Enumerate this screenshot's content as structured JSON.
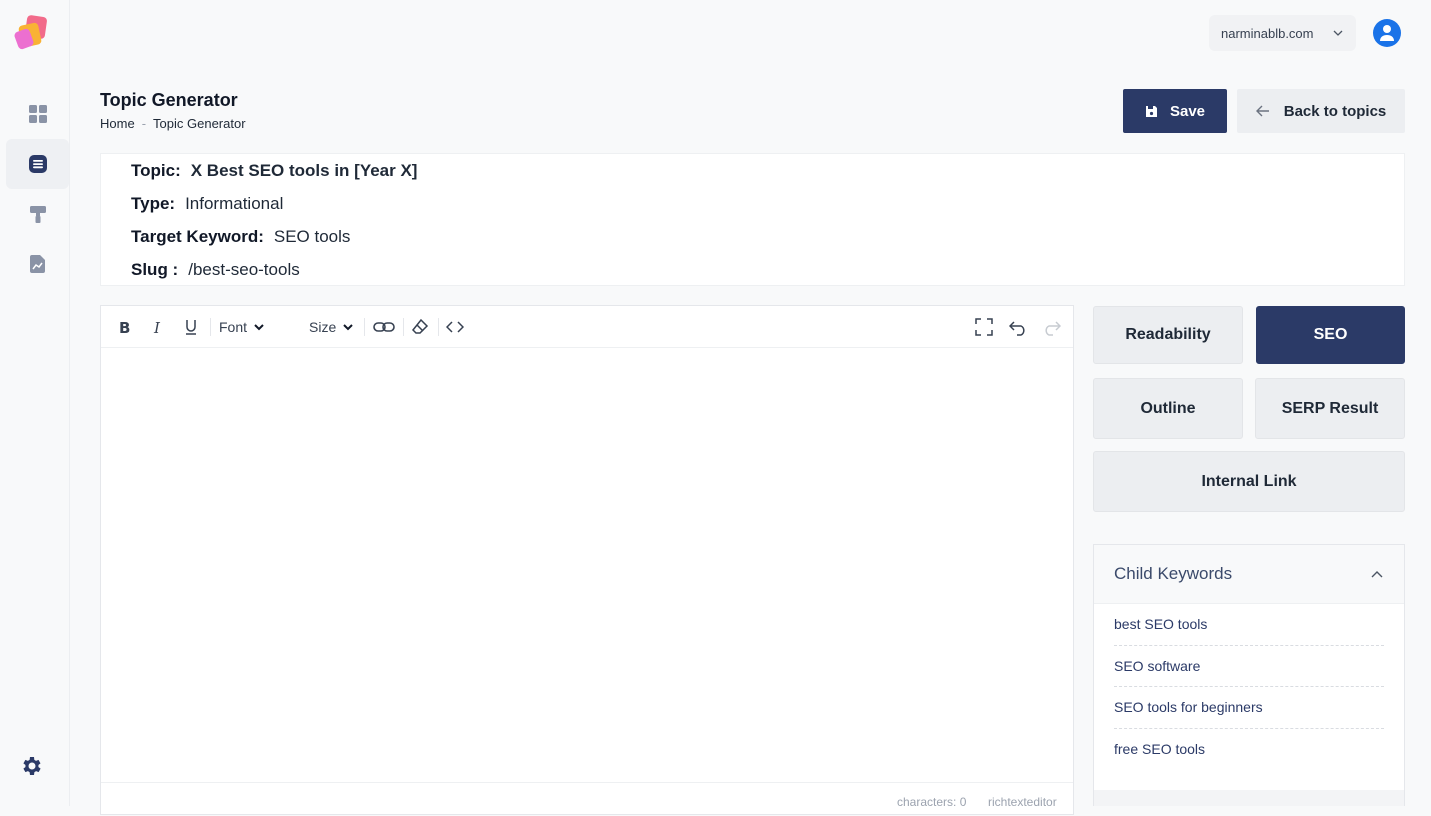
{
  "header": {
    "domain": "narminablb.com",
    "page_title": "Topic Generator",
    "breadcrumb": [
      "Home",
      "Topic Generator"
    ]
  },
  "actions": {
    "save_label": "Save",
    "back_label": "Back to topics"
  },
  "topic_info": {
    "topic_key": "Topic:",
    "topic_value": "X Best SEO tools in [Year X]",
    "type_key": "Type:",
    "type_value": "Informational",
    "keyword_key": "Target Keyword:",
    "keyword_value": "SEO tools",
    "slug_key": "Slug :",
    "slug_value": "/best-seo-tools"
  },
  "editor": {
    "font_label": "Font",
    "size_label": "Size",
    "characters": "characters: 0",
    "brand": "richtexteditor"
  },
  "tabs": {
    "readability": "Readability",
    "seo": "SEO",
    "outline": "Outline",
    "serp": "SERP Result",
    "internal_link": "Internal Link",
    "active": "SEO"
  },
  "child_keywords": {
    "title": "Child Keywords",
    "items": [
      "best SEO tools",
      "SEO software",
      "SEO tools for beginners",
      "free SEO tools"
    ]
  },
  "colors": {
    "primary": "#2b3a67",
    "avatar": "#1a73e8"
  },
  "icons": {
    "sidebar": [
      "dashboard-icon",
      "articles-icon",
      "paint-roller-icon",
      "report-icon",
      "gear-icon"
    ]
  }
}
